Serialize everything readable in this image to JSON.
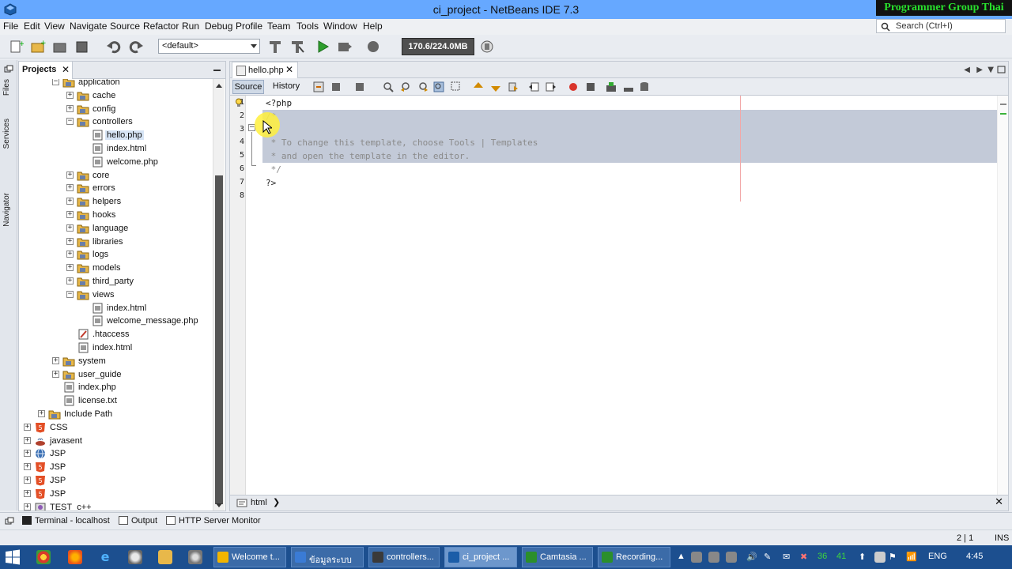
{
  "window": {
    "title": "ci_project - NetBeans IDE 7.3",
    "badge": "Programmer Group Thai"
  },
  "menu": [
    "File",
    "Edit",
    "View",
    "Navigate",
    "Source",
    "Refactor",
    "Run",
    "Debug",
    "Profile",
    "Team",
    "Tools",
    "Window",
    "Help"
  ],
  "search": {
    "placeholder": "Search (Ctrl+I)"
  },
  "toolbar": {
    "config": "<default>",
    "memory": "170.6/224.0MB"
  },
  "side_tabs": [
    "Files",
    "Services",
    "Navigator"
  ],
  "projects_panel": {
    "tab_label": "Projects",
    "tree": [
      {
        "label": "application",
        "level": 3,
        "expander": "-",
        "icon": "folder"
      },
      {
        "label": "cache",
        "level": 4,
        "expander": "+",
        "icon": "folder"
      },
      {
        "label": "config",
        "level": 4,
        "expander": "+",
        "icon": "folder"
      },
      {
        "label": "controllers",
        "level": 4,
        "expander": "-",
        "icon": "folder"
      },
      {
        "label": "hello.php",
        "level": 5,
        "expander": "",
        "icon": "file",
        "selected": true
      },
      {
        "label": "index.html",
        "level": 5,
        "expander": "",
        "icon": "file"
      },
      {
        "label": "welcome.php",
        "level": 5,
        "expander": "",
        "icon": "file"
      },
      {
        "label": "core",
        "level": 4,
        "expander": "+",
        "icon": "folder"
      },
      {
        "label": "errors",
        "level": 4,
        "expander": "+",
        "icon": "folder"
      },
      {
        "label": "helpers",
        "level": 4,
        "expander": "+",
        "icon": "folder"
      },
      {
        "label": "hooks",
        "level": 4,
        "expander": "+",
        "icon": "folder"
      },
      {
        "label": "language",
        "level": 4,
        "expander": "+",
        "icon": "folder"
      },
      {
        "label": "libraries",
        "level": 4,
        "expander": "+",
        "icon": "folder"
      },
      {
        "label": "logs",
        "level": 4,
        "expander": "+",
        "icon": "folder"
      },
      {
        "label": "models",
        "level": 4,
        "expander": "+",
        "icon": "folder"
      },
      {
        "label": "third_party",
        "level": 4,
        "expander": "+",
        "icon": "folder"
      },
      {
        "label": "views",
        "level": 4,
        "expander": "-",
        "icon": "folder"
      },
      {
        "label": "index.html",
        "level": 5,
        "expander": "",
        "icon": "file"
      },
      {
        "label": "welcome_message.php",
        "level": 5,
        "expander": "",
        "icon": "file"
      },
      {
        "label": ".htaccess",
        "level": 4,
        "expander": "",
        "icon": "htaccess"
      },
      {
        "label": "index.html",
        "level": 4,
        "expander": "",
        "icon": "file"
      },
      {
        "label": "system",
        "level": 3,
        "expander": "+",
        "icon": "folder"
      },
      {
        "label": "user_guide",
        "level": 3,
        "expander": "+",
        "icon": "folder"
      },
      {
        "label": "index.php",
        "level": 3,
        "expander": "",
        "icon": "file"
      },
      {
        "label": "license.txt",
        "level": 3,
        "expander": "",
        "icon": "file"
      },
      {
        "label": "Include Path",
        "level": 2,
        "expander": "+",
        "icon": "folder"
      },
      {
        "label": "CSS",
        "level": 1,
        "expander": "+",
        "icon": "html5"
      },
      {
        "label": "javasent",
        "level": 1,
        "expander": "+",
        "icon": "coffee"
      },
      {
        "label": "JSP",
        "level": 1,
        "expander": "+",
        "icon": "globe"
      },
      {
        "label": "JSP",
        "level": 1,
        "expander": "+",
        "icon": "html5"
      },
      {
        "label": "JSP",
        "level": 1,
        "expander": "+",
        "icon": "html5"
      },
      {
        "label": "JSP",
        "level": 1,
        "expander": "+",
        "icon": "html5"
      },
      {
        "label": "TEST_c++",
        "level": 1,
        "expander": "+",
        "icon": "cpp"
      }
    ]
  },
  "editor": {
    "tab_label": "hello.php",
    "source_label": "Source",
    "history_label": "History",
    "lines": [
      {
        "n": "1",
        "text": "<?php",
        "hl": false,
        "cls": "kw"
      },
      {
        "n": "2",
        "text": "/*",
        "hl": true,
        "cls": "cmt"
      },
      {
        "n": "3",
        "text": "",
        "hl": true,
        "cls": "cmt"
      },
      {
        "n": "4",
        "text": " * To change this template, choose Tools | Templates",
        "hl": true,
        "cls": "cmt"
      },
      {
        "n": "5",
        "text": " * and open the template in the editor.",
        "hl": true,
        "cls": "cmt"
      },
      {
        "n": "6",
        "text": " */",
        "hl": false,
        "cls": "cmt"
      },
      {
        "n": "7",
        "text": "?>",
        "hl": false,
        "cls": "kw"
      },
      {
        "n": "8",
        "text": "",
        "hl": false,
        "cls": "kw"
      }
    ],
    "breadcrumb": "html"
  },
  "output_tabs": [
    "Terminal - localhost",
    "Output",
    "HTTP Server Monitor"
  ],
  "status": {
    "position": "2 | 1",
    "mode": "INS"
  },
  "taskbar": {
    "tasks": [
      "Welcome t...",
      "ข้อมูลระบบ",
      "controllers...",
      "ci_project ...",
      "Camtasia ...",
      "Recording..."
    ],
    "lang": "ENG",
    "time": "4:45",
    "tray_numbers": [
      "36",
      "41"
    ]
  }
}
